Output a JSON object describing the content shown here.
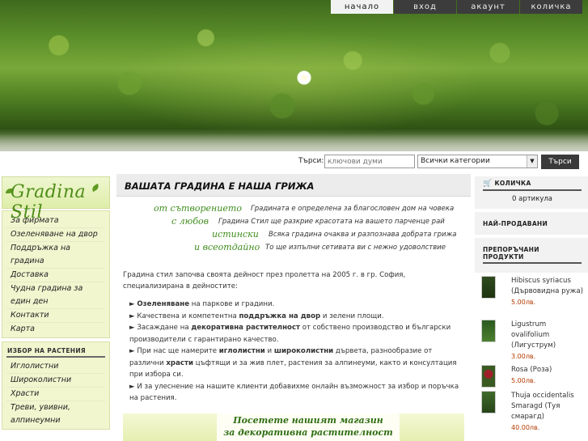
{
  "nav": {
    "tabs": [
      "начало",
      "вход",
      "акаунт",
      "количка"
    ],
    "active": "начало"
  },
  "search": {
    "label": "Търси:",
    "placeholder": "ключови думи",
    "category": "Всички категории",
    "button": "Търси"
  },
  "logo": {
    "text": "Gradina Stil"
  },
  "left_menu": {
    "items": [
      "За фирмата",
      "Озеленяване на двор",
      "Поддръжка на градина",
      "Доставка",
      "Чудна градина за един ден",
      "Контакти",
      "Карта"
    ]
  },
  "plants": {
    "title": "ИЗБОР НА РАСТЕНИЯ",
    "items": [
      "Иглолистни",
      "Широколистни",
      "Храсти",
      "Треви, увивни, алпинеумни"
    ]
  },
  "main": {
    "title": "ВАШАТА ГРАДИНА Е НАША ГРИЖА",
    "slogan": {
      "green": [
        "от сътворението",
        "с любов",
        "истински",
        "и всеотдайно"
      ],
      "gray": [
        "Градината е определена за благословен дом на човека",
        "Градина Стил ще разкрие красотата на вашето парченце рай",
        "Всяка градина очаква и разпознава добрата грижа",
        "То ще изпълни сетивата ви с нежно удоволствие"
      ]
    },
    "intro": "Градина стил започва своята дейност през пролетта на 2005 г. в гр. София, специализирана в дейностите:",
    "bullets": [
      {
        "bold": "Озеленяване",
        "rest": " на паркове и градини."
      },
      {
        "pre": "Качествена и компетентна ",
        "bold": "поддръжка на двор",
        "rest": " и зелени площи."
      },
      {
        "pre": "Засаждане на ",
        "bold": "декоративна растителност",
        "rest": " от собствено производство и български производители с гарантирано качество."
      },
      {
        "pre": "При нас ще намерите ",
        "bold": "иглолистни",
        "mid": " и ",
        "bold2": "широколистни",
        "rest": " дървета, разнообразие от различни ",
        "bold3": "храсти",
        "rest2": " цъфтящи и за жив плет, растения за алпинеуми, както и консултация при избора си."
      },
      {
        "pre": "И за улеснение на нашите клиенти добавихме онлайн възможност за избор и поръчка на растения."
      }
    ],
    "banner": [
      "Посетете нашият магазин",
      "за декоративна растителност"
    ]
  },
  "cart": {
    "title": "КОЛИЧКА",
    "count": "0 артикула"
  },
  "bestsellers": {
    "title": "НАЙ-ПРОДАВАНИ"
  },
  "recommended": {
    "title": "ПРЕПОРЪЧАНИ ПРОДУКТИ",
    "products": [
      {
        "name": "Hibiscus syriacus (Дървовидна ружа)",
        "price": "5.00лв."
      },
      {
        "name": "Ligustrum ovalifolium (Лигуструм)",
        "price": "3.00лв."
      },
      {
        "name": "Rosa (Роза)",
        "price": "5.00лв."
      },
      {
        "name": "Thuja occidentalis Smaragd (Туя смарагд)",
        "price": "40.00лв."
      }
    ]
  }
}
